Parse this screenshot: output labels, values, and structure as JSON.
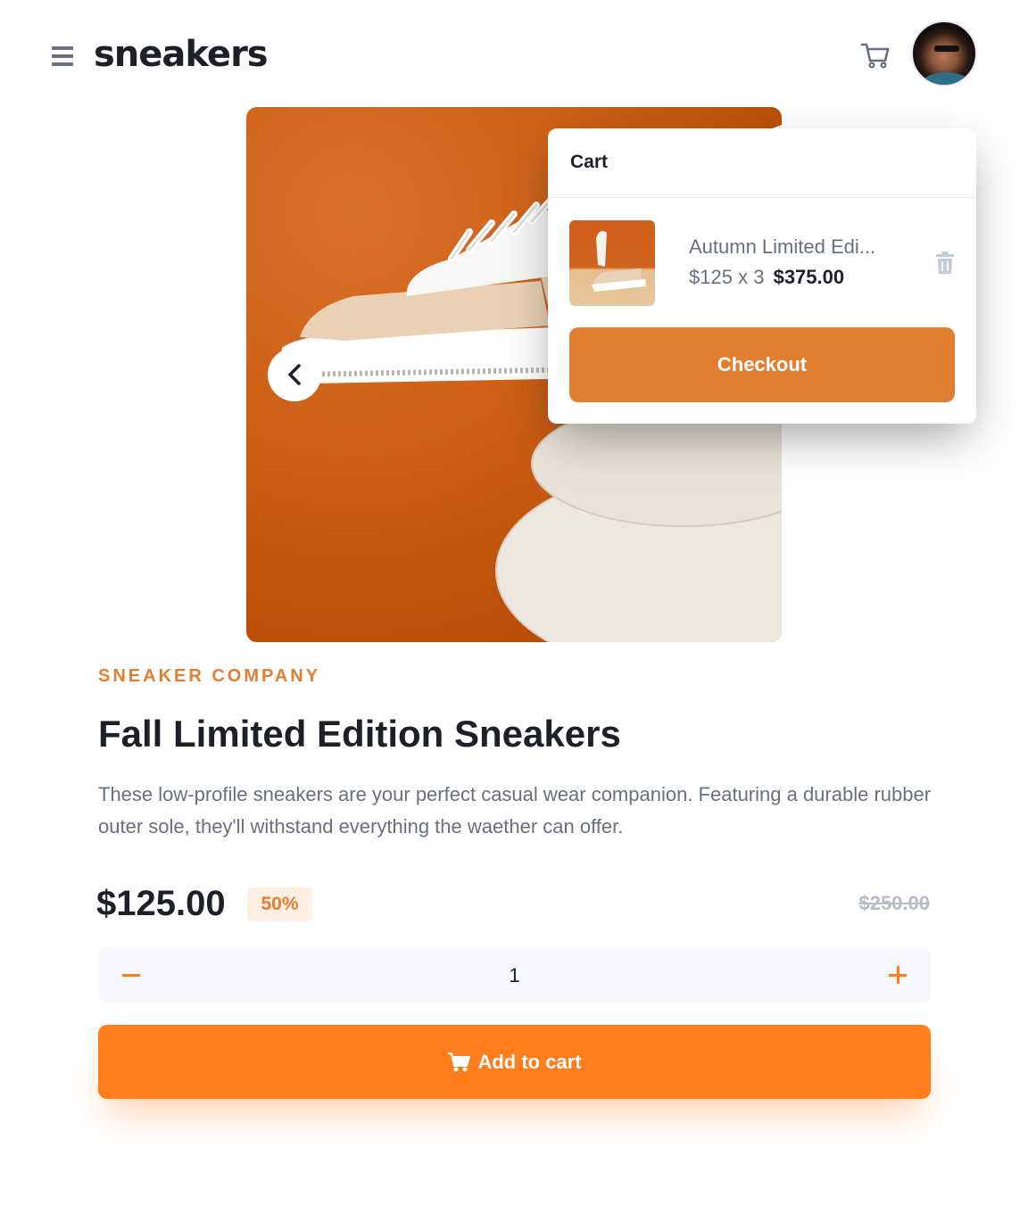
{
  "header": {
    "logo": "sneakers",
    "menu_icon": "hamburger-menu-icon",
    "cart_icon": "cart-icon",
    "avatar_alt": "user avatar"
  },
  "gallery": {
    "prev_icon": "chevron-left-icon"
  },
  "cart": {
    "title": "Cart",
    "item": {
      "name": "Autumn Limited Edi...",
      "unit_price": "$125",
      "multiplier": "x",
      "quantity": "3",
      "total": "$375.00"
    },
    "delete_icon": "trash-icon",
    "checkout_label": "Checkout"
  },
  "product": {
    "company": "SNEAKER COMPANY",
    "title": "Fall Limited Edition Sneakers",
    "description": "These low-profile sneakers are your perfect casual wear companion. Featuring a durable rubber outer sole, they'll withstand everything the waether can offer.",
    "price": "$125.00",
    "discount": "50%",
    "original_price": "$250.00"
  },
  "quantity": {
    "value": "1",
    "minus_icon": "minus-icon",
    "plus_icon": "plus-icon"
  },
  "add_to_cart": {
    "label": "Add to cart",
    "icon": "cart-icon"
  },
  "colors": {
    "orange": "#ff7e1b",
    "orange_muted": "#e27e30",
    "pale_orange": "#ffeee2",
    "dark_text": "#1d2026",
    "grey_text": "#69707d",
    "light_grey": "#f6f8fd"
  }
}
